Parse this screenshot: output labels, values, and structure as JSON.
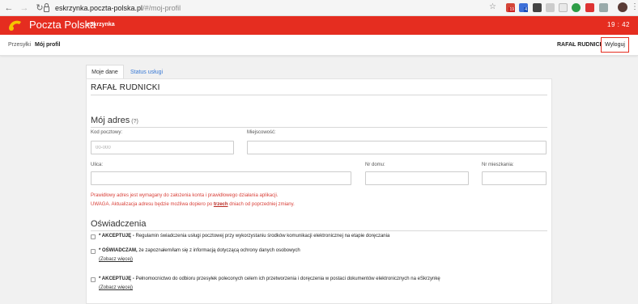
{
  "browser": {
    "url_host": "eskrzynka.poczta-polska.pl",
    "url_path": "/#/moj-profil",
    "ext_badges": [
      "19",
      "4"
    ]
  },
  "header": {
    "brand": "Poczta Polska",
    "subbrand": "eSkrzynka",
    "clock": "19 : 42",
    "accent": "#e52d20"
  },
  "nav": {
    "links": [
      "Przesyłki",
      "Mój profil"
    ],
    "user": "RAFAŁ RUDNICKI",
    "logout": "Wyloguj"
  },
  "tabs": [
    "Moje dane",
    "Status usługi"
  ],
  "profile": {
    "name": "RAFAŁ RUDNICKI"
  },
  "address": {
    "title": "Mój adres",
    "hint": "(?)",
    "postal_label": "Kod pocztowy:",
    "postal_placeholder": "00-000",
    "city_label": "Miejscowość:",
    "street_label": "Ulica:",
    "house_label": "Nr domu:",
    "apt_label": "Nr mieszkania:",
    "warning1": "Prawidłowy adres jest wymagany do założenia konta i prawidłowego działania aplikacji.",
    "warning2_pre": "UWAGA. Aktualizacja adresu będzie możliwa dopiero po ",
    "warning2_link": "trzech",
    "warning2_post": " dniach od poprzedniej zmiany."
  },
  "declarations": {
    "title": "Oświadczenia",
    "items": [
      {
        "bold": "* AKCEPTUJĘ -",
        "text": " Regulamin świadczenia usługi pocztowej przy wykorzystaniu środków komunikacji elektronicznej na etapie doręczania",
        "more": ""
      },
      {
        "bold": "* OŚWIADCZAM,",
        "text": " że zapoznałem/łam się z informacją dotyczącą ochrony danych osobowych",
        "more": "(Zobacz więcej)"
      },
      {
        "bold": "* AKCEPTUJĘ -",
        "text": " Pełnomocnictwo do odbioru przesyłek poleconych celem ich przetworzenia i doręczenia w postaci dokumentów elektronicznych na eSkrzynkę",
        "more": "(Zobacz więcej)"
      }
    ]
  }
}
